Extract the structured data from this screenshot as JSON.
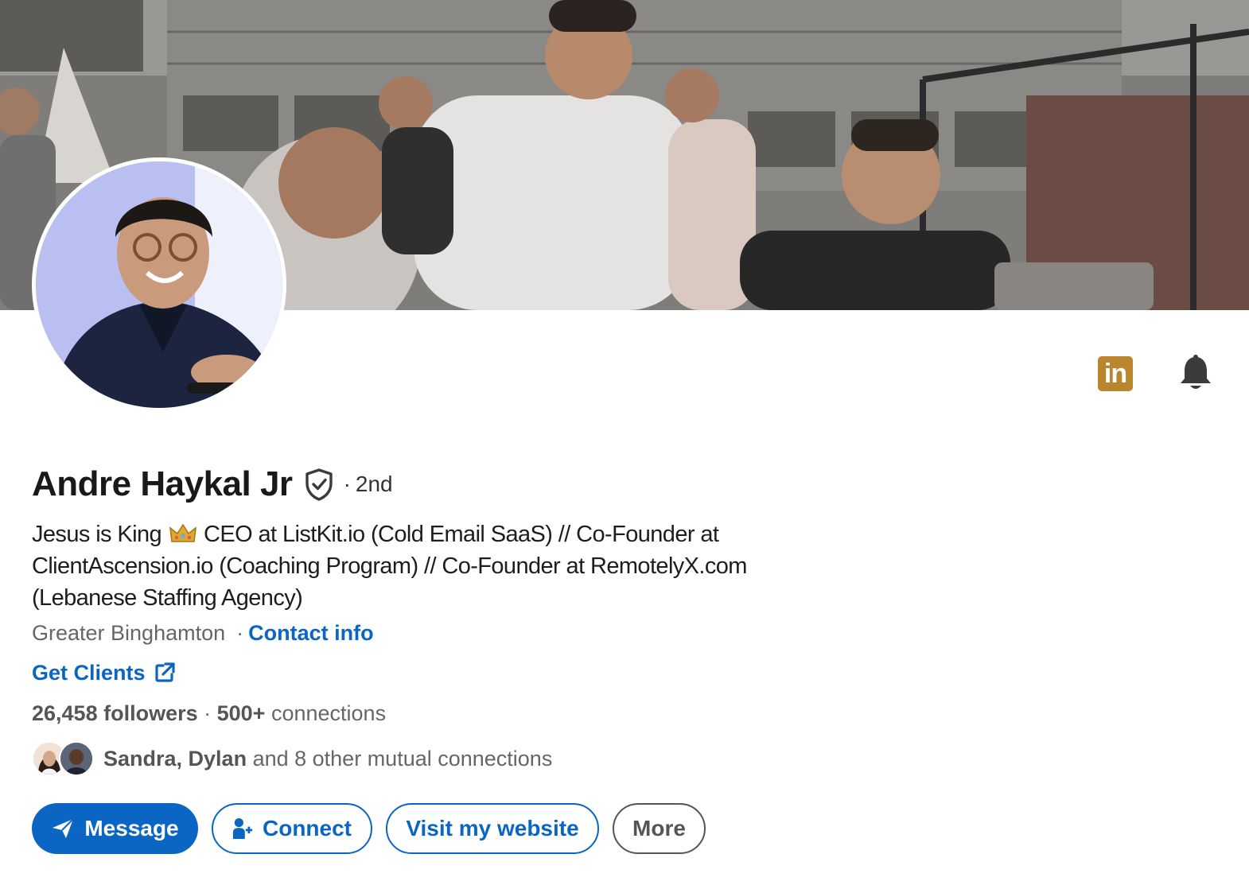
{
  "profile": {
    "name": "Andre Haykal Jr",
    "degree": "2nd",
    "headline_before_icon": "Jesus is King",
    "headline_after_icon": "CEO at ListKit.io (Cold Email SaaS) // Co-Founder at ClientAscension.io (Coaching Program) // Co-Founder at RemotelyX.com (Lebanese Staffing Agency)",
    "headline_icon": "crown-icon",
    "location": "Greater Binghamton",
    "contact_info_label": "Contact info",
    "website_label": "Get Clients",
    "followers": "26,458 followers",
    "connections_count": "500+",
    "connections_label": "connections",
    "mutual_names": "Sandra, Dylan",
    "mutual_suffix": "and 8 other mutual connections"
  },
  "header_icons": {
    "linkedin_badge": "in",
    "linkedin_icon": "linkedin-icon",
    "bell_icon": "bell-icon"
  },
  "actions": {
    "message_label": "Message",
    "connect_label": "Connect",
    "website_label": "Visit my website",
    "more_label": "More"
  },
  "colors": {
    "link_blue": "#0a66c2",
    "badge_gold": "#b9862f",
    "text_muted": "#666666"
  }
}
